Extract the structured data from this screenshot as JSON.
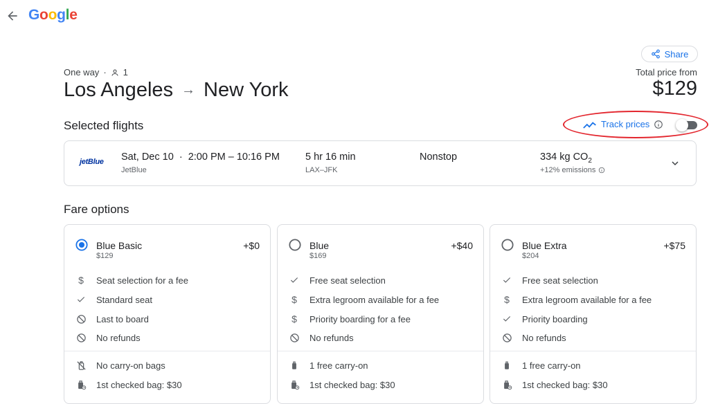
{
  "header": {
    "logo_text": "Google"
  },
  "share": {
    "label": "Share"
  },
  "trip": {
    "type": "One way",
    "passengers": "1",
    "from": "Los Angeles",
    "to": "New York"
  },
  "price": {
    "label": "Total price from",
    "value": "$129"
  },
  "selected_flights": {
    "title": "Selected flights"
  },
  "track": {
    "label": "Track prices",
    "enabled": false
  },
  "flight": {
    "airline_logo": "jetBlue",
    "date": "Sat, Dec 10",
    "times": "2:00 PM – 10:16 PM",
    "airline": "JetBlue",
    "duration": "5 hr 16 min",
    "route": "LAX–JFK",
    "stops": "Nonstop",
    "emissions": "334 kg CO",
    "emissions_sub": "2",
    "emissions_delta": "+12% emissions"
  },
  "fare_options": {
    "title": "Fare options",
    "cards": [
      {
        "name": "Blue Basic",
        "price": "$129",
        "add": "+$0",
        "selected": true,
        "features": [
          {
            "icon": "dollar-icon",
            "text": "Seat selection for a fee"
          },
          {
            "icon": "check-icon",
            "text": "Standard seat"
          },
          {
            "icon": "block-icon",
            "text": "Last to board"
          },
          {
            "icon": "block-icon",
            "text": "No refunds"
          }
        ],
        "bags": [
          {
            "icon": "no-bag-icon",
            "text": "No carry-on bags"
          },
          {
            "icon": "checked-bag-icon",
            "text": "1st checked bag: $30"
          }
        ]
      },
      {
        "name": "Blue",
        "price": "$169",
        "add": "+$40",
        "selected": false,
        "features": [
          {
            "icon": "check-icon",
            "text": "Free seat selection"
          },
          {
            "icon": "dollar-icon",
            "text": "Extra legroom available for a fee"
          },
          {
            "icon": "dollar-icon",
            "text": "Priority boarding for a fee"
          },
          {
            "icon": "block-icon",
            "text": "No refunds"
          }
        ],
        "bags": [
          {
            "icon": "carry-on-icon",
            "text": "1 free carry-on"
          },
          {
            "icon": "checked-bag-icon",
            "text": "1st checked bag: $30"
          }
        ]
      },
      {
        "name": "Blue Extra",
        "price": "$204",
        "add": "+$75",
        "selected": false,
        "features": [
          {
            "icon": "check-icon",
            "text": "Free seat selection"
          },
          {
            "icon": "dollar-icon",
            "text": "Extra legroom available for a fee"
          },
          {
            "icon": "check-icon",
            "text": "Priority boarding"
          },
          {
            "icon": "block-icon",
            "text": "No refunds"
          }
        ],
        "bags": [
          {
            "icon": "carry-on-icon",
            "text": "1 free carry-on"
          },
          {
            "icon": "checked-bag-icon",
            "text": "1st checked bag: $30"
          }
        ]
      }
    ]
  },
  "colors": {
    "accent": "#1a73e8",
    "annotation": "#e3262e"
  }
}
